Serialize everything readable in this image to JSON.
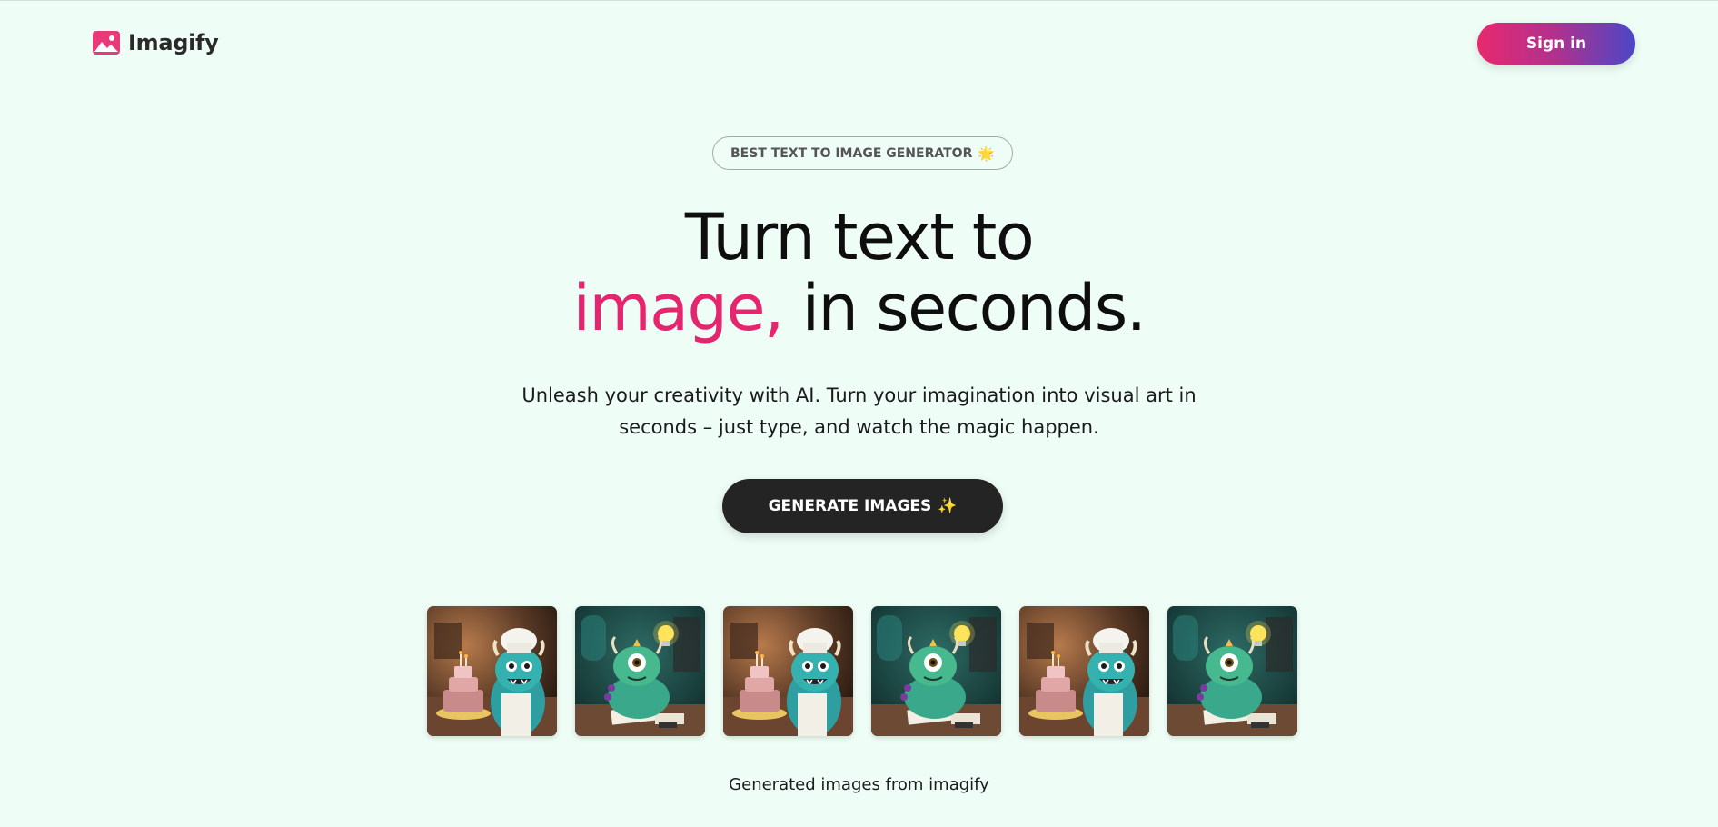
{
  "brand": {
    "name": "Imagify",
    "icon": "image-icon",
    "accent": "#e5266f"
  },
  "header": {
    "signin_label": "Sign in"
  },
  "badge": {
    "text": "BEST TEXT TO IMAGE GENERATOR",
    "icon": "sun-icon",
    "emoji": "🌟"
  },
  "hero": {
    "line1": "Turn text to",
    "accent_word": "image,",
    "line2_rest": "in seconds."
  },
  "subtitle": {
    "line1": "Unleash your creativity with AI. Turn your imagination into visual art in",
    "line2": "seconds – just type, and watch the magic happen."
  },
  "cta": {
    "label": "GENERATE IMAGES",
    "icon": "sparkle-icon",
    "emoji": "✨"
  },
  "gallery": {
    "images": [
      {
        "subject": "monster-chef-cake"
      },
      {
        "subject": "monster-writing-lightbulb"
      },
      {
        "subject": "monster-chef-cake"
      },
      {
        "subject": "monster-writing-lightbulb"
      },
      {
        "subject": "monster-chef-cake"
      },
      {
        "subject": "monster-writing-lightbulb"
      }
    ],
    "caption": "Generated images from imagify"
  },
  "colors": {
    "background": "#effdf7",
    "signin_gradient_start": "#e8296f",
    "signin_gradient_end": "#4a48c6",
    "cta_background": "#242424"
  }
}
